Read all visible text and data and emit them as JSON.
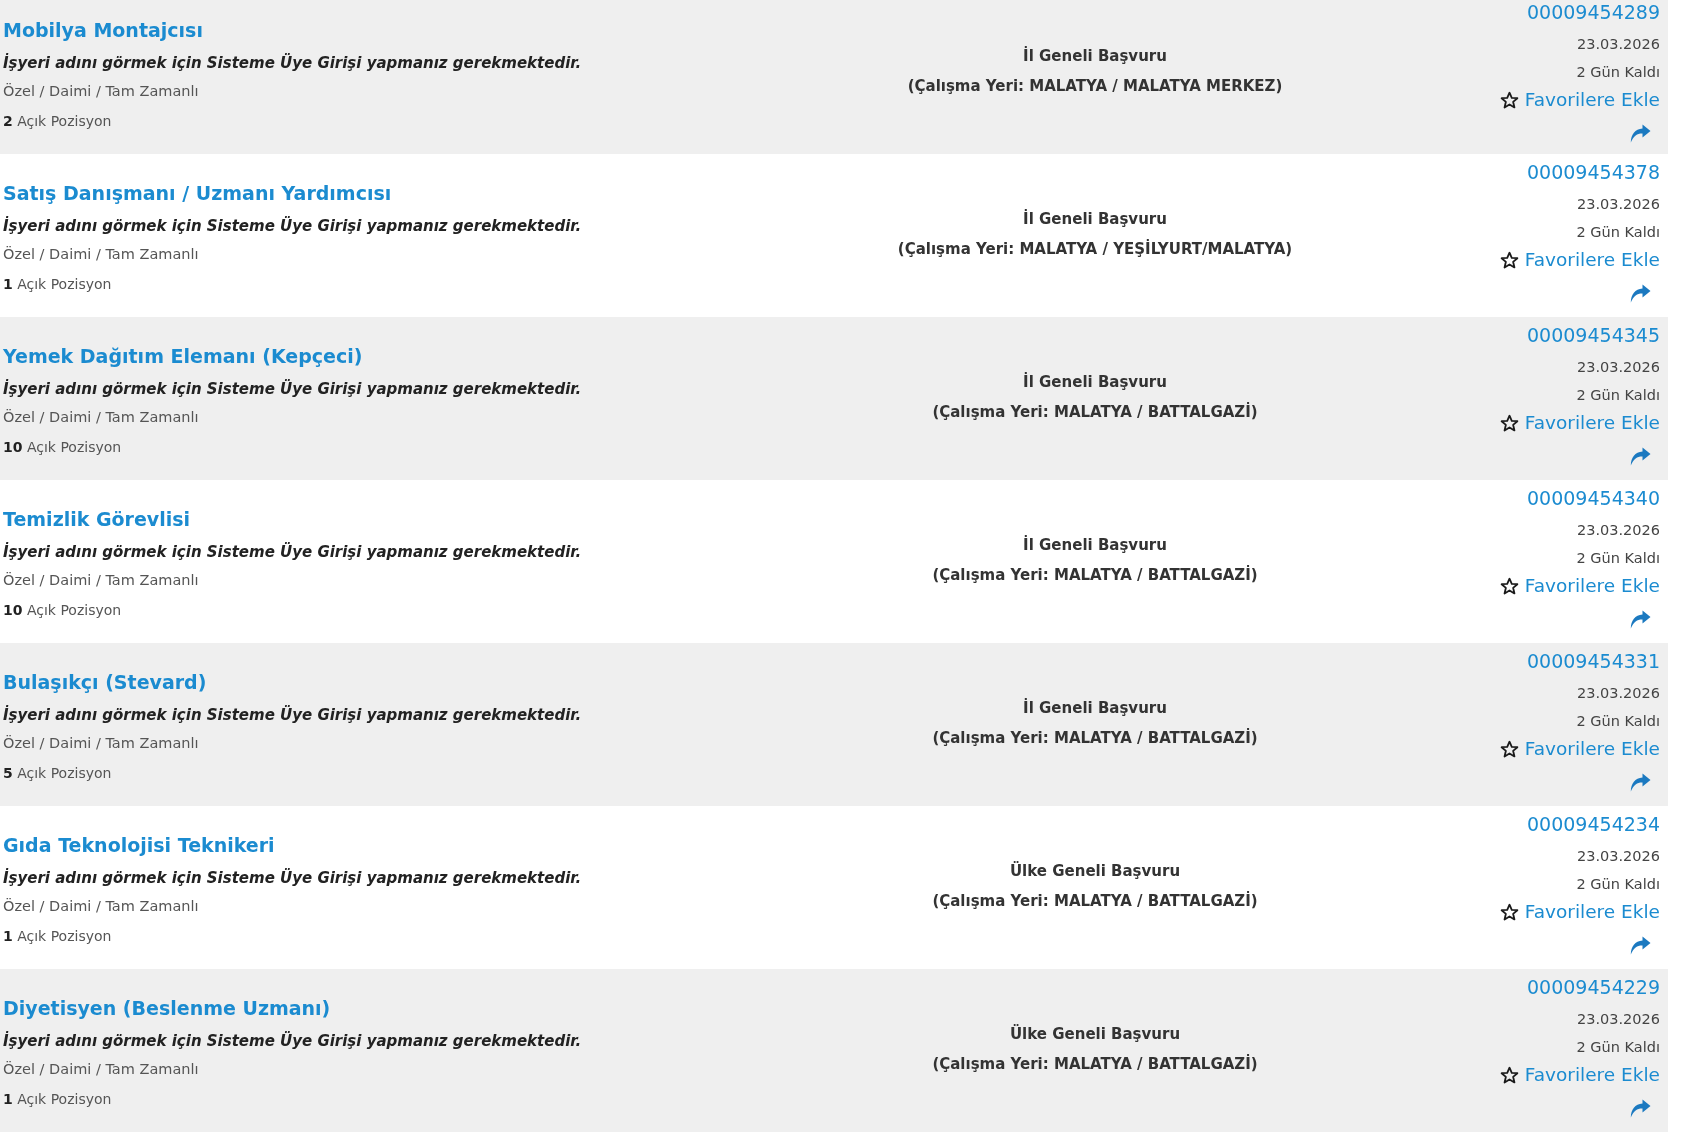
{
  "listings": [
    {
      "title": "Mobilya Montajcısı",
      "notice": "İşyeri adını görmek için Sisteme Üye Girişi yapmanız gerekmektedir.",
      "employment": "Özel / Daimi / Tam Zamanlı",
      "openings": "**2** Açık Pozisyon",
      "scope": "İl Geneli Başvuru",
      "workplace": "(Çalışma Yeri: MALATYA / MALATYA MERKEZ)",
      "id": "00009454289",
      "date": "23.03.2026",
      "remaining": "2 Gün Kaldı",
      "favorite_label": "Favorilere Ekle"
    },
    {
      "title": "Satış Danışmanı / Uzmanı Yardımcısı",
      "notice": "İşyeri adını görmek için Sisteme Üye Girişi yapmanız gerekmektedir.",
      "employment": "Özel / Daimi / Tam Zamanlı",
      "openings": "**1** Açık Pozisyon",
      "scope": "İl Geneli Başvuru",
      "workplace": "(Çalışma Yeri: MALATYA / YEŞİLYURT/MALATYA)",
      "id": "00009454378",
      "date": "23.03.2026",
      "remaining": "2 Gün Kaldı",
      "favorite_label": "Favorilere Ekle"
    },
    {
      "title": "Yemek Dağıtım Elemanı (Kepçeci)",
      "notice": "İşyeri adını görmek için Sisteme Üye Girişi yapmanız gerekmektedir.",
      "employment": "Özel / Daimi / Tam Zamanlı",
      "openings": "**10** Açık Pozisyon",
      "scope": "İl Geneli Başvuru",
      "workplace": "(Çalışma Yeri: MALATYA / BATTALGAZİ)",
      "id": "00009454345",
      "date": "23.03.2026",
      "remaining": "2 Gün Kaldı",
      "favorite_label": "Favorilere Ekle"
    },
    {
      "title": "Temizlik Görevlisi",
      "notice": "İşyeri adını görmek için Sisteme Üye Girişi yapmanız gerekmektedir.",
      "employment": "Özel / Daimi / Tam Zamanlı",
      "openings": "**10** Açık Pozisyon",
      "scope": "İl Geneli Başvuru",
      "workplace": "(Çalışma Yeri: MALATYA / BATTALGAZİ)",
      "id": "00009454340",
      "date": "23.03.2026",
      "remaining": "2 Gün Kaldı",
      "favorite_label": "Favorilere Ekle"
    },
    {
      "title": "Bulaşıkçı (Stevard)",
      "notice": "İşyeri adını görmek için Sisteme Üye Girişi yapmanız gerekmektedir.",
      "employment": "Özel / Daimi / Tam Zamanlı",
      "openings": "**5** Açık Pozisyon",
      "scope": "İl Geneli Başvuru",
      "workplace": "(Çalışma Yeri: MALATYA / BATTALGAZİ)",
      "id": "00009454331",
      "date": "23.03.2026",
      "remaining": "2 Gün Kaldı",
      "favorite_label": "Favorilere Ekle"
    },
    {
      "title": "Gıda Teknolojisi Teknikeri",
      "notice": "İşyeri adını görmek için Sisteme Üye Girişi yapmanız gerekmektedir.",
      "employment": "Özel / Daimi / Tam Zamanlı",
      "openings": "**1** Açık Pozisyon",
      "scope": "Ülke Geneli Başvuru",
      "workplace": "(Çalışma Yeri: MALATYA / BATTALGAZİ)",
      "id": "00009454234",
      "date": "23.03.2026",
      "remaining": "2 Gün Kaldı",
      "favorite_label": "Favorilere Ekle"
    },
    {
      "title": "Diyetisyen (Beslenme Uzmanı)",
      "notice": "İşyeri adını görmek için Sisteme Üye Girişi yapmanız gerekmektedir.",
      "employment": "Özel / Daimi / Tam Zamanlı",
      "openings": "**1** Açık Pozisyon",
      "scope": "Ülke Geneli Başvuru",
      "workplace": "(Çalışma Yeri: MALATYA / BATTALGAZİ)",
      "id": "00009454229",
      "date": "23.03.2026",
      "remaining": "2 Gün Kaldı",
      "favorite_label": "Favorilere Ekle"
    }
  ]
}
